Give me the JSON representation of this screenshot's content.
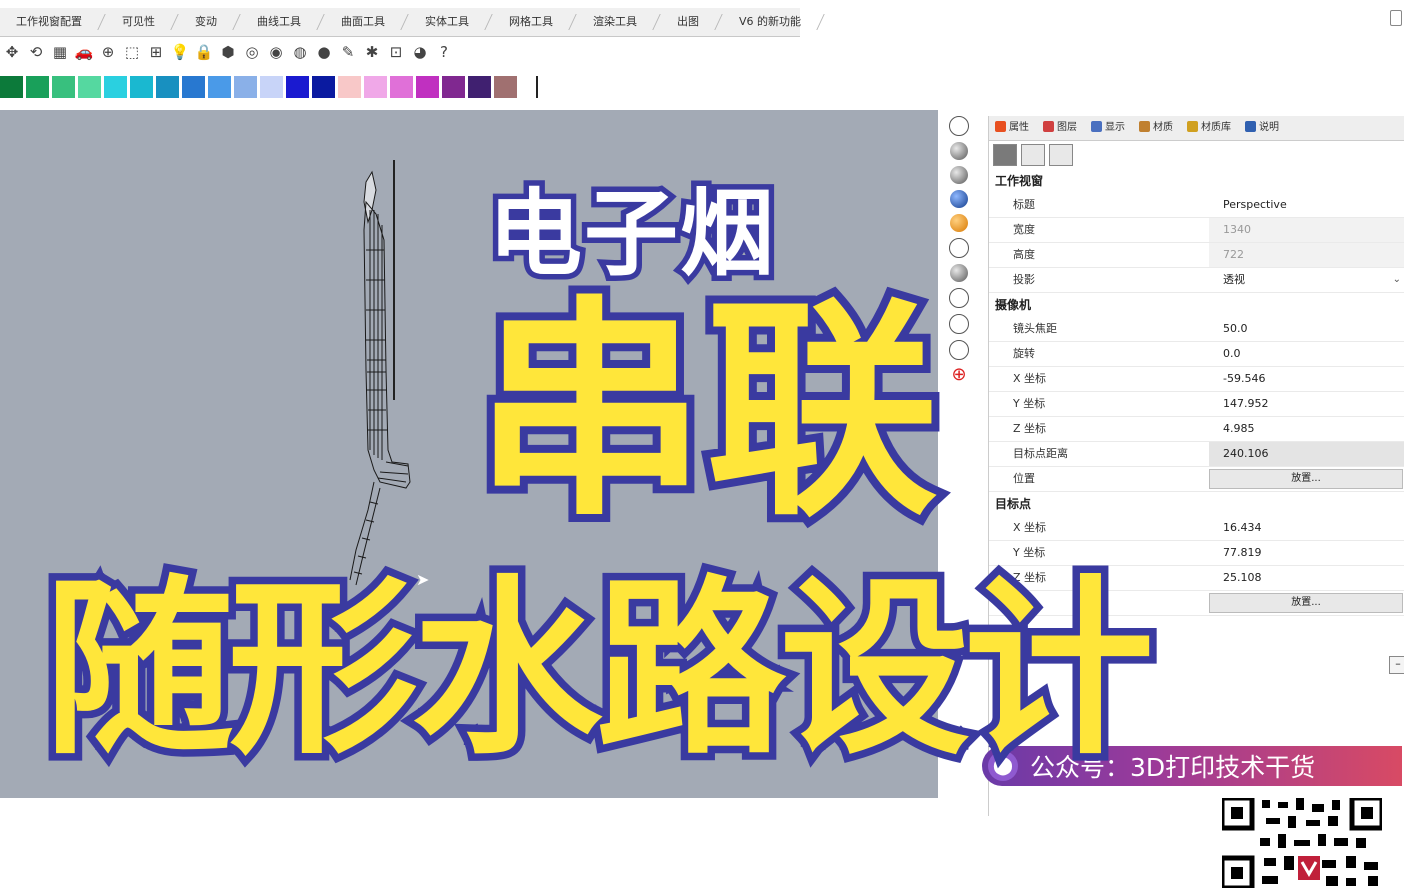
{
  "tabs": [
    "工作视窗配置",
    "可见性",
    "变动",
    "曲线工具",
    "曲面工具",
    "实体工具",
    "网格工具",
    "渲染工具",
    "出图",
    "V6 的新功能"
  ],
  "toolbar_icons": [
    "pan-icon",
    "rotate-view-icon",
    "viewport-layout-icon",
    "car-icon",
    "zoom-icon",
    "zoom-window-icon",
    "named-view-icon",
    "lightbulb-icon",
    "lock-icon",
    "shaded-icon",
    "color-wheel-icon",
    "render-sphere-icon",
    "render-preview-icon",
    "material-sphere-icon",
    "highlight-icon",
    "settings-gear-icon",
    "layout-icon",
    "globe-icon",
    "help-icon"
  ],
  "swatches": [
    "#0c7a3a",
    "#19a05a",
    "#38c07e",
    "#55d8a0",
    "#2ad0e0",
    "#1ab8d0",
    "#1890c0",
    "#2878d0",
    "#4a9ae8",
    "#8ab0e8",
    "#c8d4f8",
    "#1a1ad0",
    "#0a1aa0",
    "#f8c8c8",
    "#f0a8e8",
    "#e070d8",
    "#c030c0",
    "#802890",
    "#402070",
    "#a07070"
  ],
  "panel": {
    "tabs": [
      {
        "label": "属性",
        "color": "#e85020"
      },
      {
        "label": "图层",
        "color": "#d04040"
      },
      {
        "label": "显示",
        "color": "#4a70c0"
      },
      {
        "label": "材质",
        "color": "#c08030"
      },
      {
        "label": "材质库",
        "color": "#d0a020"
      },
      {
        "label": "说明",
        "color": "#3060b0"
      }
    ],
    "sections": {
      "viewport": "工作视窗",
      "camera": "摄像机",
      "target": "目标点"
    },
    "viewport_rows": [
      {
        "label": "标题",
        "value": "Perspective"
      },
      {
        "label": "宽度",
        "value": "1340"
      },
      {
        "label": "高度",
        "value": "722"
      },
      {
        "label": "投影",
        "value": "透视"
      }
    ],
    "camera_rows": [
      {
        "label": "镜头焦距",
        "value": "50.0"
      },
      {
        "label": "旋转",
        "value": "0.0"
      },
      {
        "label": "X 坐标",
        "value": "-59.546"
      },
      {
        "label": "Y 坐标",
        "value": "147.952"
      },
      {
        "label": "Z 坐标",
        "value": "4.985"
      },
      {
        "label": "目标点距离",
        "value": "240.106"
      },
      {
        "label": "位置",
        "value": "放置..."
      }
    ],
    "target_rows": [
      {
        "label": "X 坐标",
        "value": "16.434"
      },
      {
        "label": "Y 坐标",
        "value": "77.819"
      },
      {
        "label": "Z 坐标",
        "value": "25.108"
      }
    ],
    "target_button": "放置..."
  },
  "banner": {
    "text": "公众号：3D打印技术干货"
  },
  "overlay": {
    "line1": "电子烟",
    "line2": "串联",
    "line3": "随形水路设计"
  },
  "colors": {
    "viewport_bg": "#a3aab5",
    "overlay_yellow": "#ffe63a",
    "overlay_outline": "#3a3aa0"
  }
}
